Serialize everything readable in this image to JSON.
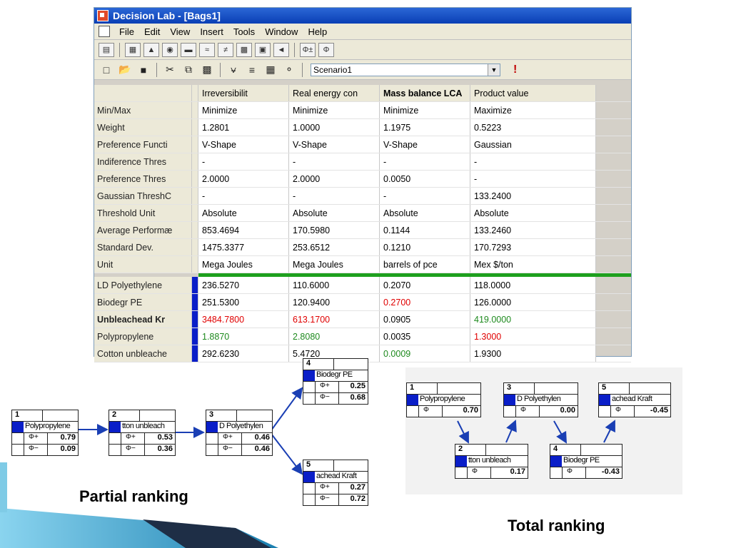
{
  "window": {
    "title": "Decision Lab - [Bags1]"
  },
  "menu": [
    "File",
    "Edit",
    "View",
    "Insert",
    "Tools",
    "Window",
    "Help"
  ],
  "toolbar2": {
    "scenario": "Scenario1",
    "warn": "!"
  },
  "grid": {
    "columns": [
      "Irreversibilit",
      "Real energy con",
      "Mass balance LCA",
      "Product value"
    ],
    "props": [
      {
        "label": "Min/Max",
        "values": [
          "Minimize",
          "Minimize",
          "Minimize",
          "Maximize"
        ]
      },
      {
        "label": "Weight",
        "values": [
          "1.2801",
          "1.0000",
          "1.1975",
          "0.5223"
        ]
      },
      {
        "label": "Preference Functi",
        "values": [
          "V-Shape",
          "V-Shape",
          "V-Shape",
          "Gaussian"
        ]
      },
      {
        "label": "Indiference Thres",
        "values": [
          "-",
          "-",
          "-",
          "-"
        ]
      },
      {
        "label": "Preference Thres",
        "values": [
          "2.0000",
          "2.0000",
          "0.0050",
          "-"
        ]
      },
      {
        "label": "Gaussian ThreshϹ",
        "values": [
          "-",
          "-",
          "-",
          "133.2400"
        ]
      },
      {
        "label": "Threshold Unit",
        "values": [
          "Absolute",
          "Absolute",
          "Absolute",
          "Absolute"
        ]
      },
      {
        "label": "Average Performæ",
        "values": [
          "853.4694",
          "170.5980",
          "0.1144",
          "133.2460"
        ]
      },
      {
        "label": "Standard Dev.",
        "values": [
          "1475.3377",
          "253.6512",
          "0.1210",
          "170.7293"
        ]
      },
      {
        "label": "Unit",
        "values": [
          "Mega Joules",
          "Mega Joules",
          "barrels of pce",
          "Mex $/ton"
        ]
      }
    ],
    "actions": [
      {
        "label": "LD Polyethylene",
        "bold": false,
        "values": [
          "236.5270",
          "110.6000",
          "0.2070",
          "118.0000"
        ],
        "colors": [
          "",
          "",
          "",
          ""
        ]
      },
      {
        "label": "Biodegr PE",
        "bold": false,
        "values": [
          "251.5300",
          "120.9400",
          "0.2700",
          "126.0000"
        ],
        "colors": [
          "",
          "",
          "red",
          ""
        ]
      },
      {
        "label": "Unbleachead Kr",
        "bold": true,
        "values": [
          "3484.7800",
          "613.1700",
          "0.0905",
          "419.0000"
        ],
        "colors": [
          "red",
          "red",
          "",
          "green"
        ]
      },
      {
        "label": "Polypropylene",
        "bold": false,
        "values": [
          "1.8870",
          "2.8080",
          "0.0035",
          "1.3000"
        ],
        "colors": [
          "green",
          "green",
          "",
          "red"
        ]
      },
      {
        "label": "Cotton unbleache",
        "bold": false,
        "values": [
          "292.6230",
          "5.4720",
          "0.0009",
          "1.9300"
        ],
        "colors": [
          "",
          "",
          "green",
          ""
        ]
      }
    ]
  },
  "colors": {
    "marker": "#0a1ec8",
    "greenbar": "#1ea01e",
    "arrow": "#1a3fb4"
  },
  "partial": {
    "label": "Partial ranking",
    "nodes": [
      {
        "rank": "1",
        "name": "Polypropylene",
        "plus_label": "Φ+",
        "plus": "0.79",
        "minus_label": "Φ−",
        "minus": "0.09"
      },
      {
        "rank": "2",
        "name": "tton unbleach",
        "plus_label": "Φ+",
        "plus": "0.53",
        "minus_label": "Φ−",
        "minus": "0.36"
      },
      {
        "rank": "3",
        "name": "D Polyethylen",
        "plus_label": "Φ+",
        "plus": "0.46",
        "minus_label": "Φ−",
        "minus": "0.46"
      },
      {
        "rank": "4",
        "name": "Biodegr PE",
        "plus_label": "Φ+",
        "plus": "0.25",
        "minus_label": "Φ−",
        "minus": "0.68"
      },
      {
        "rank": "5",
        "name": "achead Kraft",
        "plus_label": "Φ+",
        "plus": "0.27",
        "minus_label": "Φ−",
        "minus": "0.72"
      }
    ]
  },
  "total": {
    "label": "Total ranking",
    "nodes": [
      {
        "rank": "1",
        "name": "Polypropylene",
        "phi_label": "Φ",
        "phi": "0.70"
      },
      {
        "rank": "2",
        "name": "tton unbleach",
        "phi_label": "Φ",
        "phi": "0.17"
      },
      {
        "rank": "3",
        "name": "D Polyethylen",
        "phi_label": "Φ",
        "phi": "0.00"
      },
      {
        "rank": "4",
        "name": "Biodegr PE",
        "phi_label": "Φ",
        "phi": "-0.43"
      },
      {
        "rank": "5",
        "name": "achead Kraft",
        "phi_label": "Φ",
        "phi": "-0.45"
      }
    ]
  }
}
